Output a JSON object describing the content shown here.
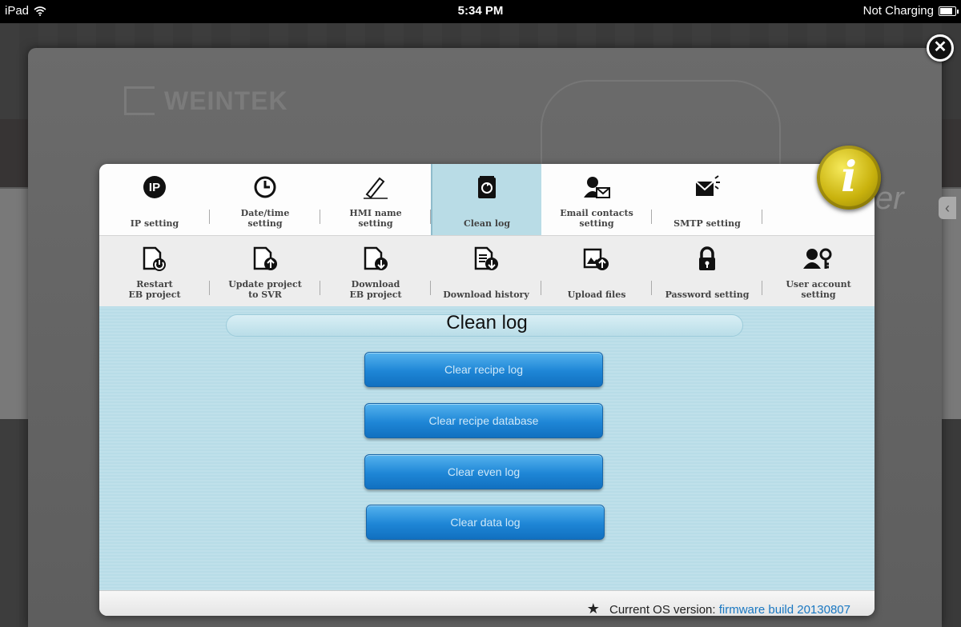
{
  "status_bar": {
    "device": "iPad",
    "time": "5:34 PM",
    "charging": "Not Charging",
    "battery_level": 0.9
  },
  "background": {
    "brand": "WEINTEK",
    "partial_text": "er"
  },
  "dialog": {
    "tabs_row1": [
      {
        "id": "ip",
        "label": "IP setting",
        "icon": "ip-icon"
      },
      {
        "id": "datetime",
        "label": "Date/time\nsetting",
        "icon": "clock-icon"
      },
      {
        "id": "hminame",
        "label": "HMI name\nsetting",
        "icon": "pen-icon"
      },
      {
        "id": "cleanlog",
        "label": "Clean log",
        "icon": "recycle-bin-icon",
        "active": true
      },
      {
        "id": "email",
        "label": "Email contacts\nsetting",
        "icon": "contact-mail-icon"
      },
      {
        "id": "smtp",
        "label": "SMTP setting",
        "icon": "mail-send-icon"
      },
      {
        "id": "blank",
        "label": "",
        "icon": ""
      }
    ],
    "tabs_row2": [
      {
        "id": "restart",
        "label": "Restart\nEB project",
        "icon": "restart-doc-icon"
      },
      {
        "id": "update",
        "label": "Update project\nto SVR",
        "icon": "upload-doc-icon"
      },
      {
        "id": "download",
        "label": "Download\nEB project",
        "icon": "download-doc-icon"
      },
      {
        "id": "history",
        "label": "Download history",
        "icon": "history-doc-icon"
      },
      {
        "id": "upload",
        "label": "Upload files",
        "icon": "upload-image-icon"
      },
      {
        "id": "password",
        "label": "Password setting",
        "icon": "lock-icon"
      },
      {
        "id": "useraccount",
        "label": "User account\nsetting",
        "icon": "user-key-icon"
      }
    ],
    "content": {
      "title": "Clean log",
      "buttons": [
        "Clear recipe log",
        "Clear recipe database",
        "Clear even log",
        "Clear data log"
      ]
    },
    "footer": {
      "label": "Current OS version:",
      "version": "firmware build 20130807"
    }
  },
  "colors": {
    "accent_blue": "#1e86d6",
    "active_tab": "#b9dce6",
    "content_bg": "#bfe0ea",
    "info_badge": "#d4bd15"
  }
}
